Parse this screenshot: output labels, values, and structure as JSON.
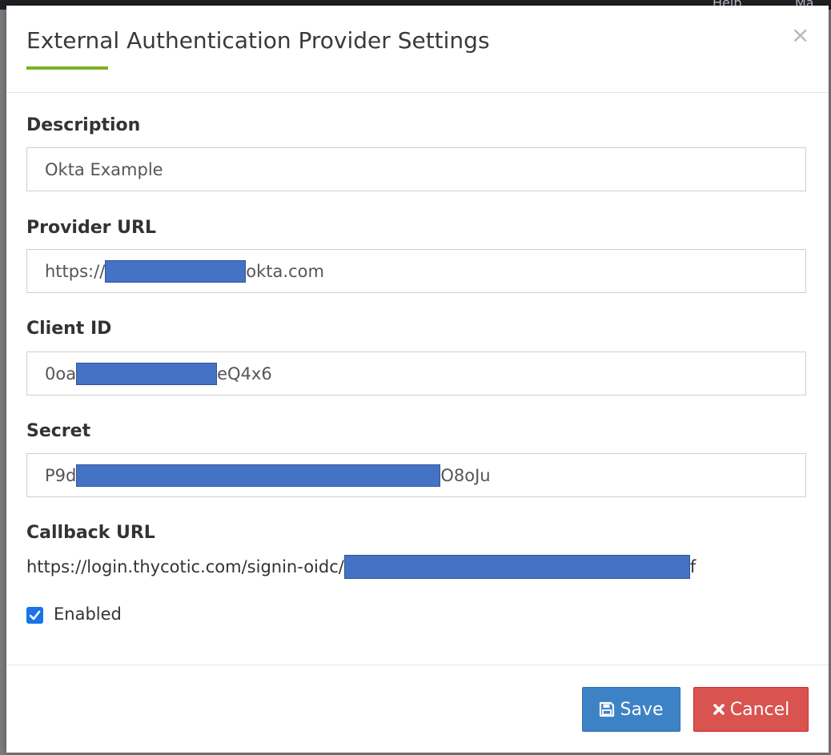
{
  "backdrop": {
    "menu_help": "Help",
    "menu_other": "Ma"
  },
  "modal": {
    "title": "External Authentication Provider Settings",
    "close_glyph": "×",
    "fields": {
      "description": {
        "label": "Description",
        "value": "Okta Example"
      },
      "provider_url": {
        "label": "Provider URL",
        "value_prefix": "https://",
        "value_suffix": "okta.com"
      },
      "client_id": {
        "label": "Client ID",
        "value_prefix": "0oa",
        "value_suffix": "eQ4x6"
      },
      "secret": {
        "label": "Secret",
        "value_prefix": "P9d",
        "value_suffix": "O8oJu"
      },
      "callback_url": {
        "label": "Callback URL",
        "value_prefix": "https://login.thycotic.com/signin-oidc/",
        "value_suffix": "f"
      }
    },
    "enabled": {
      "label": "Enabled",
      "checked": true
    },
    "buttons": {
      "save": {
        "label": "Save",
        "icon": "save-icon"
      },
      "cancel": {
        "label": "Cancel",
        "icon": "close-icon"
      }
    },
    "colors": {
      "accent_underline": "#7fb11f",
      "save_button": "#3e82c6",
      "cancel_button": "#d9534f",
      "redaction": "#4472c4",
      "checkbox": "#1a73e8"
    }
  }
}
